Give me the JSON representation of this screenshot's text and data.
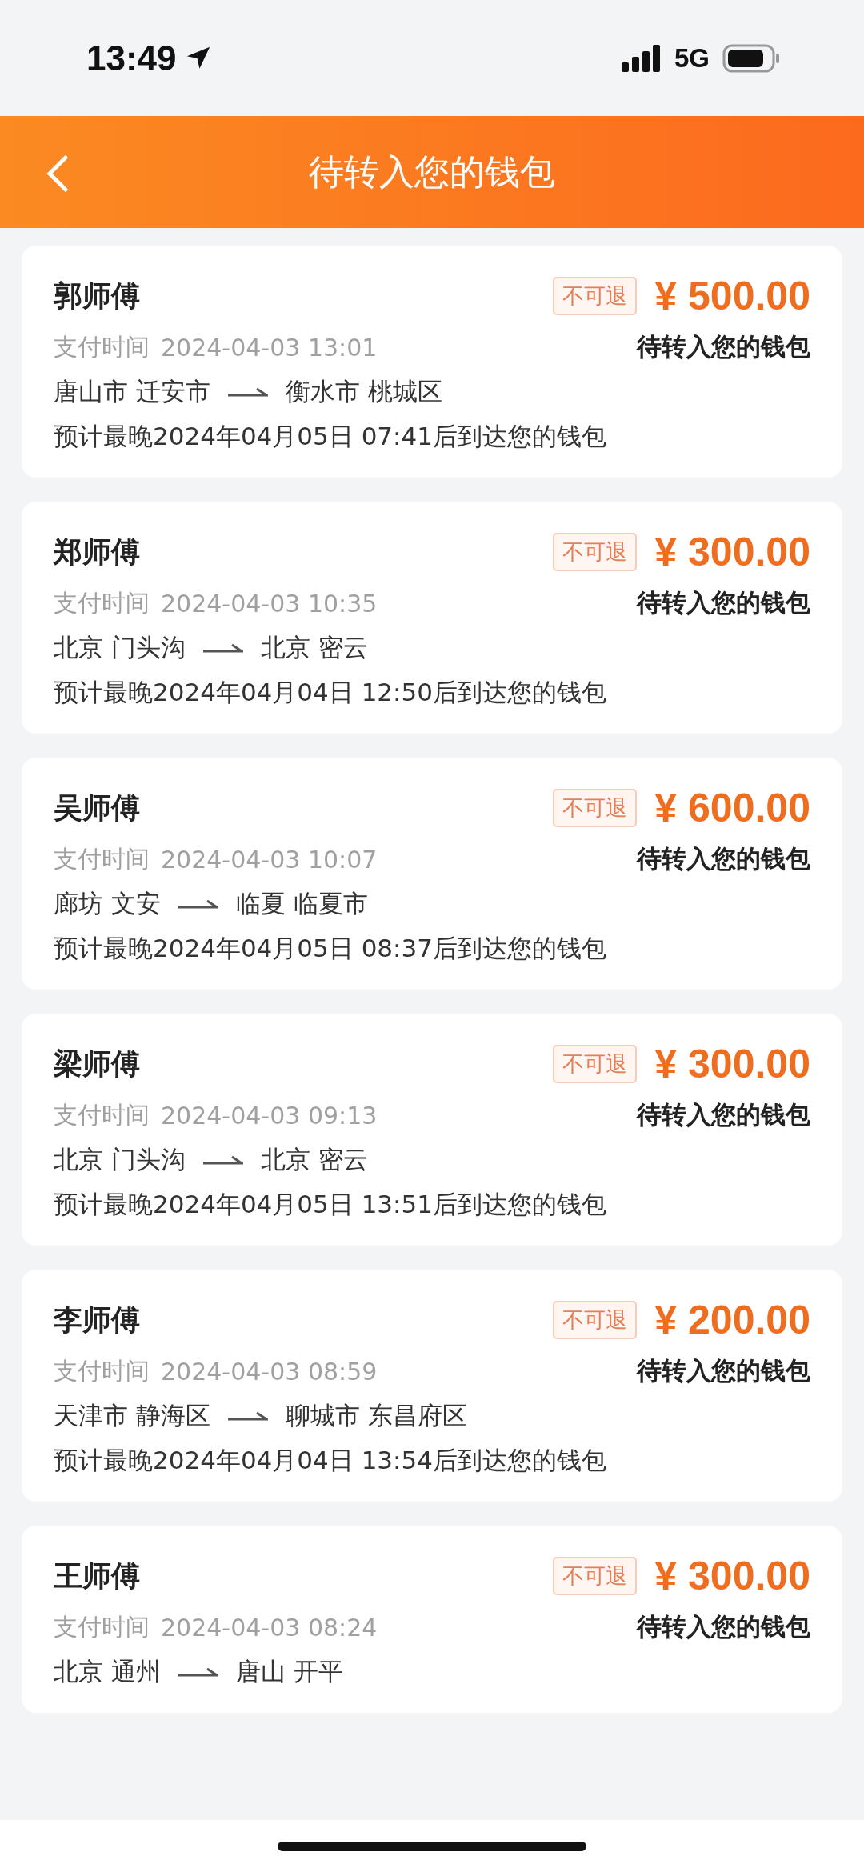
{
  "status_bar": {
    "time": "13:49",
    "network": "5G"
  },
  "header": {
    "title": "待转入您的钱包"
  },
  "orders": [
    {
      "driver": "郭师傅",
      "tag": "不可退",
      "amount": "¥ 500.00",
      "paid_label": "支付时间",
      "paid_time": "2024-04-03 13:01",
      "status": "待转入您的钱包",
      "from": "唐山市 迁安市",
      "to": "衡水市 桃城区",
      "eta": "预计最晚2024年04月05日 07:41后到达您的钱包"
    },
    {
      "driver": "郑师傅",
      "tag": "不可退",
      "amount": "¥ 300.00",
      "paid_label": "支付时间",
      "paid_time": "2024-04-03 10:35",
      "status": "待转入您的钱包",
      "from": "北京 门头沟",
      "to": "北京 密云",
      "eta": "预计最晚2024年04月04日 12:50后到达您的钱包"
    },
    {
      "driver": "吴师傅",
      "tag": "不可退",
      "amount": "¥ 600.00",
      "paid_label": "支付时间",
      "paid_time": "2024-04-03 10:07",
      "status": "待转入您的钱包",
      "from": "廊坊 文安",
      "to": "临夏 临夏市",
      "eta": "预计最晚2024年04月05日 08:37后到达您的钱包"
    },
    {
      "driver": "梁师傅",
      "tag": "不可退",
      "amount": "¥ 300.00",
      "paid_label": "支付时间",
      "paid_time": "2024-04-03 09:13",
      "status": "待转入您的钱包",
      "from": "北京 门头沟",
      "to": "北京 密云",
      "eta": "预计最晚2024年04月05日 13:51后到达您的钱包"
    },
    {
      "driver": "李师傅",
      "tag": "不可退",
      "amount": "¥ 200.00",
      "paid_label": "支付时间",
      "paid_time": "2024-04-03 08:59",
      "status": "待转入您的钱包",
      "from": "天津市 静海区",
      "to": "聊城市 东昌府区",
      "eta": "预计最晚2024年04月04日 13:54后到达您的钱包"
    },
    {
      "driver": "王师傅",
      "tag": "不可退",
      "amount": "¥ 300.00",
      "paid_label": "支付时间",
      "paid_time": "2024-04-03 08:24",
      "status": "待转入您的钱包",
      "from": "北京 通州",
      "to": "唐山 开平"
    }
  ]
}
